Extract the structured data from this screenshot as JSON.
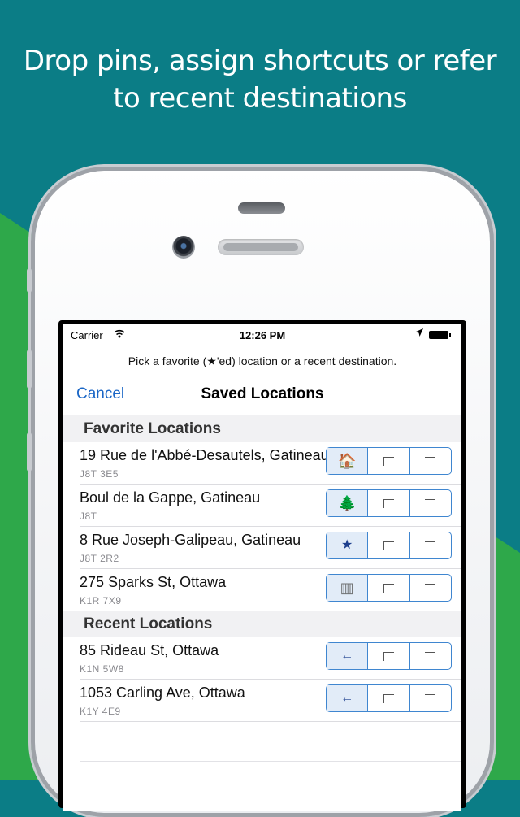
{
  "headline": {
    "line1": "Drop pins, assign shortcuts or refer",
    "line2": "to recent destinations"
  },
  "colors": {
    "teal": "#0b7d86",
    "green": "#2ea84a",
    "accent": "#1a66c6"
  },
  "status_bar": {
    "carrier": "Carrier",
    "wifi_icon": "wifi-icon",
    "time": "12:26 PM",
    "location_icon": "location-arrow-icon",
    "battery_icon": "battery-icon"
  },
  "prompt": "Pick a favorite (★'ed) location or a recent destination.",
  "nav": {
    "cancel": "Cancel",
    "title": "Saved Locations"
  },
  "sections": {
    "favorites": {
      "title": "Favorite Locations",
      "items": [
        {
          "title": "19 Rue de l'Abbé-Desautels, Gatineau",
          "sub": "J8T 3E5",
          "shortcut_icon": "home-icon",
          "shortcut_glyph": "🏠"
        },
        {
          "title": "Boul de la Gappe, Gatineau",
          "sub": "J8T",
          "shortcut_icon": "tree-icon",
          "shortcut_glyph": "🌲"
        },
        {
          "title": "8 Rue Joseph-Galipeau, Gatineau",
          "sub": "J8T 2R2",
          "shortcut_icon": "star-icon",
          "shortcut_glyph": "★"
        },
        {
          "title": "275 Sparks St, Ottawa",
          "sub": "K1R 7X9",
          "shortcut_icon": "building-icon",
          "shortcut_glyph": "▥"
        }
      ]
    },
    "recent": {
      "title": "Recent Locations",
      "items": [
        {
          "title": "85 Rideau St, Ottawa",
          "sub": "K1N 5W8",
          "shortcut_icon": "arrow-left-icon",
          "shortcut_glyph": "←"
        },
        {
          "title": "1053 Carling Ave, Ottawa",
          "sub": "K1Y 4E9",
          "shortcut_icon": "arrow-left-icon",
          "shortcut_glyph": "←"
        }
      ]
    }
  }
}
